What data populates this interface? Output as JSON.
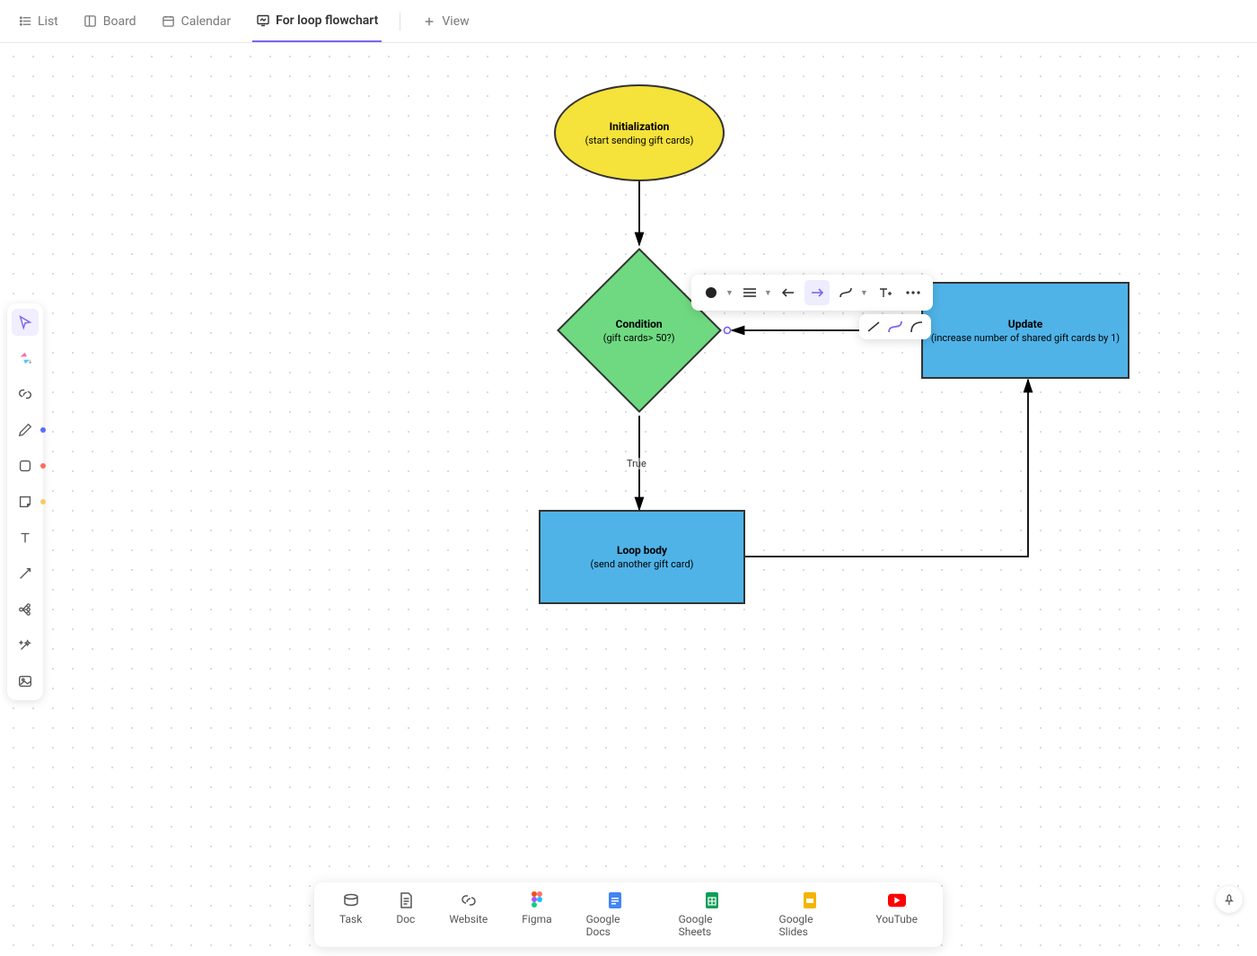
{
  "tabs": {
    "list": "List",
    "board": "Board",
    "calendar": "Calendar",
    "flowchart": "For loop flowchart",
    "addview": "View"
  },
  "flow": {
    "init_title": "Initialization",
    "init_sub": "(start sending gift cards)",
    "cond_title": "Condition",
    "cond_sub": "(gift cards> 50?)",
    "body_title": "Loop body",
    "body_sub": "(send another gift card)",
    "update_title": "Update",
    "update_sub": "(increase number of shared gift cards by 1)",
    "edge_true": "True"
  },
  "dock": {
    "task": "Task",
    "doc": "Doc",
    "website": "Website",
    "figma": "Figma",
    "gdocs": "Google Docs",
    "gsheets": "Google Sheets",
    "gslides": "Google Slides",
    "youtube": "YouTube"
  }
}
